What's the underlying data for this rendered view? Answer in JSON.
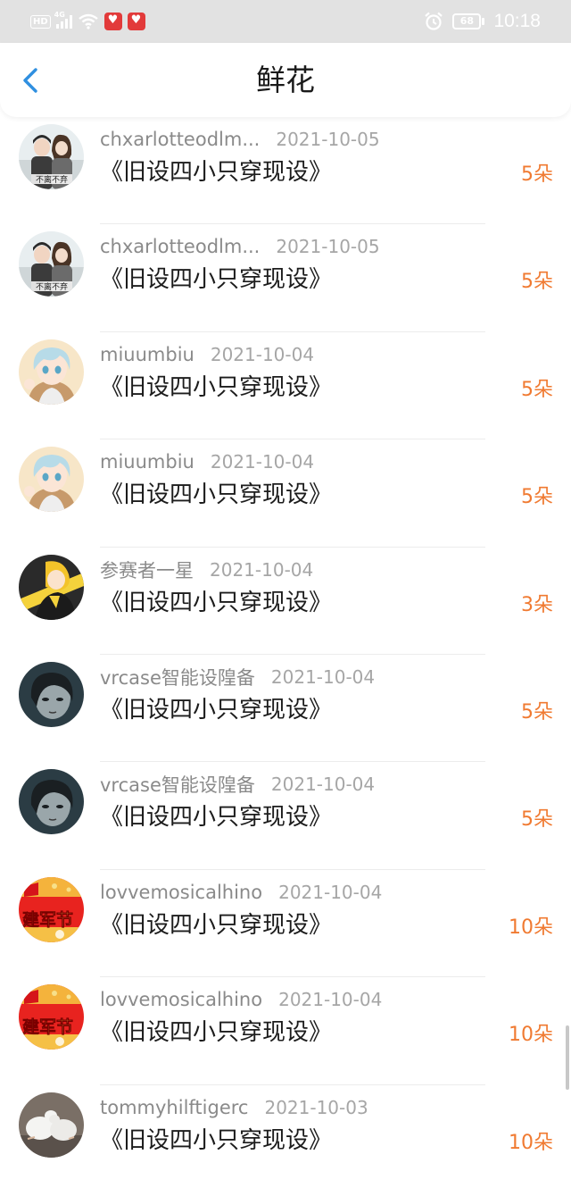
{
  "status_bar": {
    "hd": "HD",
    "signal": "4G",
    "battery": "68",
    "time": "10:18"
  },
  "header": {
    "title": "鲜花"
  },
  "list": [
    {
      "user": "chxarlotteodlm...",
      "date": "2021-10-05",
      "work": "《旧设四小只穿现设》",
      "count": "5朵",
      "avatar": "avatar-couple"
    },
    {
      "user": "chxarlotteodlm...",
      "date": "2021-10-05",
      "work": "《旧设四小只穿现设》",
      "count": "5朵",
      "avatar": "avatar-couple"
    },
    {
      "user": "miuumbiu",
      "date": "2021-10-04",
      "work": "《旧设四小只穿现设》",
      "count": "5朵",
      "avatar": "avatar-anime-blue"
    },
    {
      "user": "miuumbiu",
      "date": "2021-10-04",
      "work": "《旧设四小只穿现设》",
      "count": "5朵",
      "avatar": "avatar-anime-blue"
    },
    {
      "user": "参赛者一星",
      "date": "2021-10-04",
      "work": "《旧设四小只穿现设》",
      "count": "3朵",
      "avatar": "avatar-anime-yellow"
    },
    {
      "user": "vrcase智能设隍备",
      "date": "2021-10-04",
      "work": "《旧设四小只穿现设》",
      "count": "5朵",
      "avatar": "avatar-dark-portrait"
    },
    {
      "user": "vrcase智能设隍备",
      "date": "2021-10-04",
      "work": "《旧设四小只穿现设》",
      "count": "5朵",
      "avatar": "avatar-dark-portrait"
    },
    {
      "user": "lovvemosicalhino",
      "date": "2021-10-04",
      "work": "《旧设四小只穿现设》",
      "count": "10朵",
      "avatar": "avatar-army-day",
      "avatar_text": "建军节"
    },
    {
      "user": "lovvemosicalhino",
      "date": "2021-10-04",
      "work": "《旧设四小只穿现设》",
      "count": "10朵",
      "avatar": "avatar-army-day",
      "avatar_text": "建军节"
    },
    {
      "user": "tommyhilftigerc",
      "date": "2021-10-03",
      "work": "《旧设四小只穿现设》",
      "count": "10朵",
      "avatar": "avatar-doves"
    }
  ],
  "colors": {
    "accent": "#f07a31",
    "back": "#2f8fe0",
    "status_bar": "#e2e2e2"
  }
}
